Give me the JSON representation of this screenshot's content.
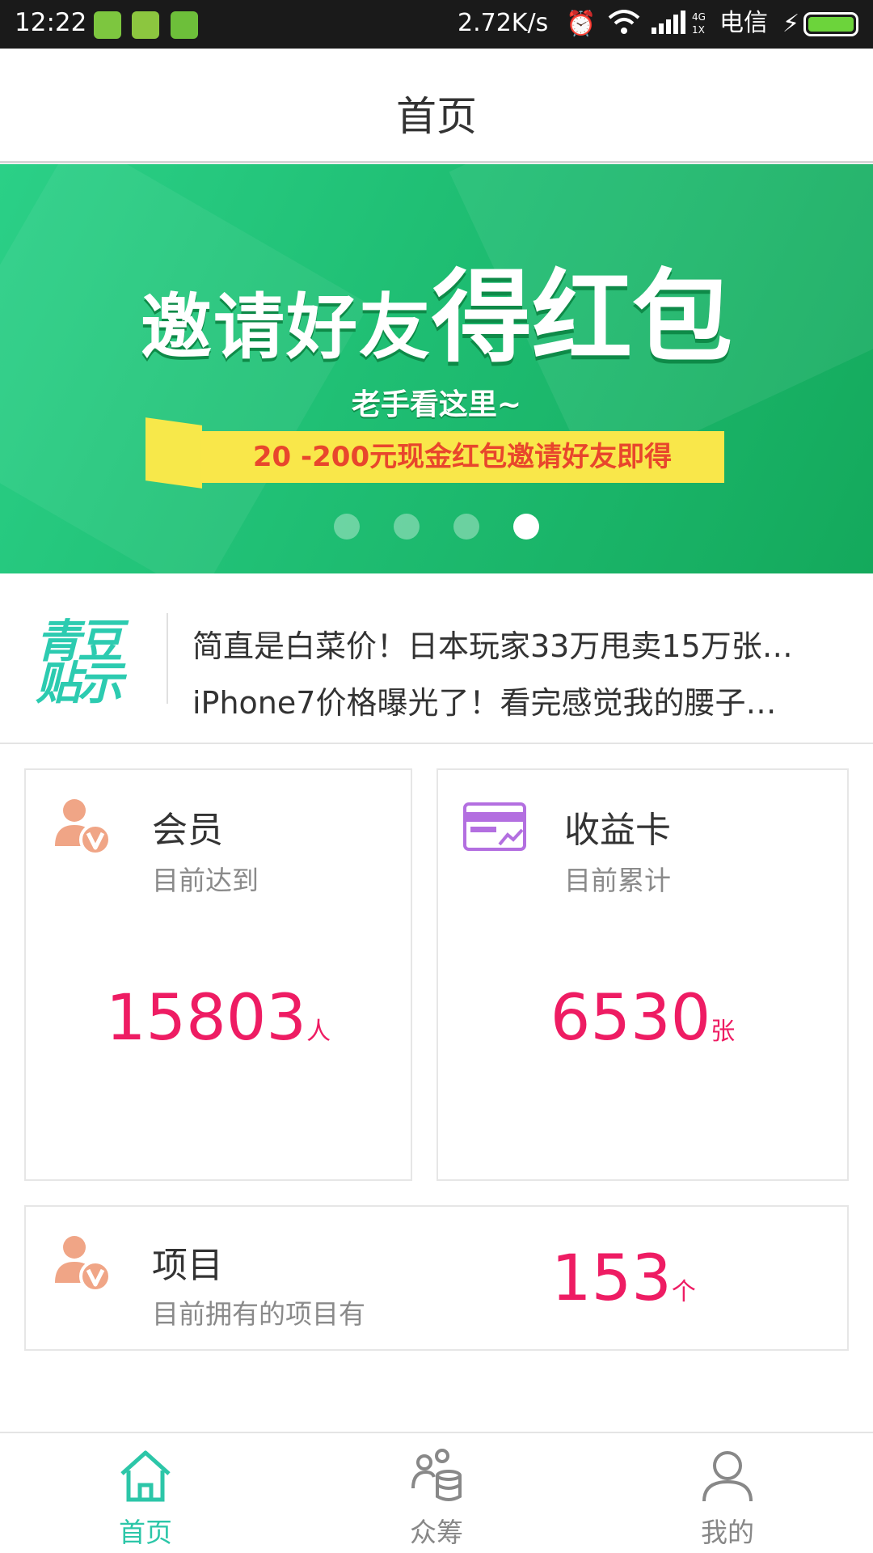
{
  "status_bar": {
    "time": "12:22",
    "net_speed": "2.72K/s",
    "network": "4G",
    "carrier": "电信"
  },
  "header": {
    "title": "首页"
  },
  "banner": {
    "headline_small": "邀请好友",
    "headline_big": "得红包",
    "subtitle": "老手看这里~",
    "ribbon": "20 -200元现金红包邀请好友即得",
    "slide_count": 4,
    "active_slide": 4
  },
  "news": {
    "logo": "青豆贴示",
    "items": [
      "简直是白菜价！日本玩家33万甩卖15万张…",
      "iPhone7价格曝光了！看完感觉我的腰子…"
    ]
  },
  "stats": {
    "members": {
      "title": "会员",
      "subtitle": "目前达到",
      "value": "15803",
      "unit": "人",
      "icon": "member-icon"
    },
    "yield_cards": {
      "title": "收益卡",
      "subtitle": "目前累计",
      "value": "6530",
      "unit": "张",
      "icon": "card-icon"
    },
    "projects": {
      "title": "项目",
      "subtitle": "目前拥有的项目有",
      "value": "153",
      "unit": "个",
      "icon": "member-icon"
    }
  },
  "bottom_nav": [
    {
      "label": "首页",
      "icon": "home-icon",
      "active": true
    },
    {
      "label": "众筹",
      "icon": "crowdfunding-icon",
      "active": false
    },
    {
      "label": "我的",
      "icon": "profile-icon",
      "active": false
    }
  ],
  "colors": {
    "accent": "#2cc6a8",
    "value": "#ee1c63",
    "banner_green": "#1fbe73",
    "ribbon_yellow": "#f9e74a"
  }
}
